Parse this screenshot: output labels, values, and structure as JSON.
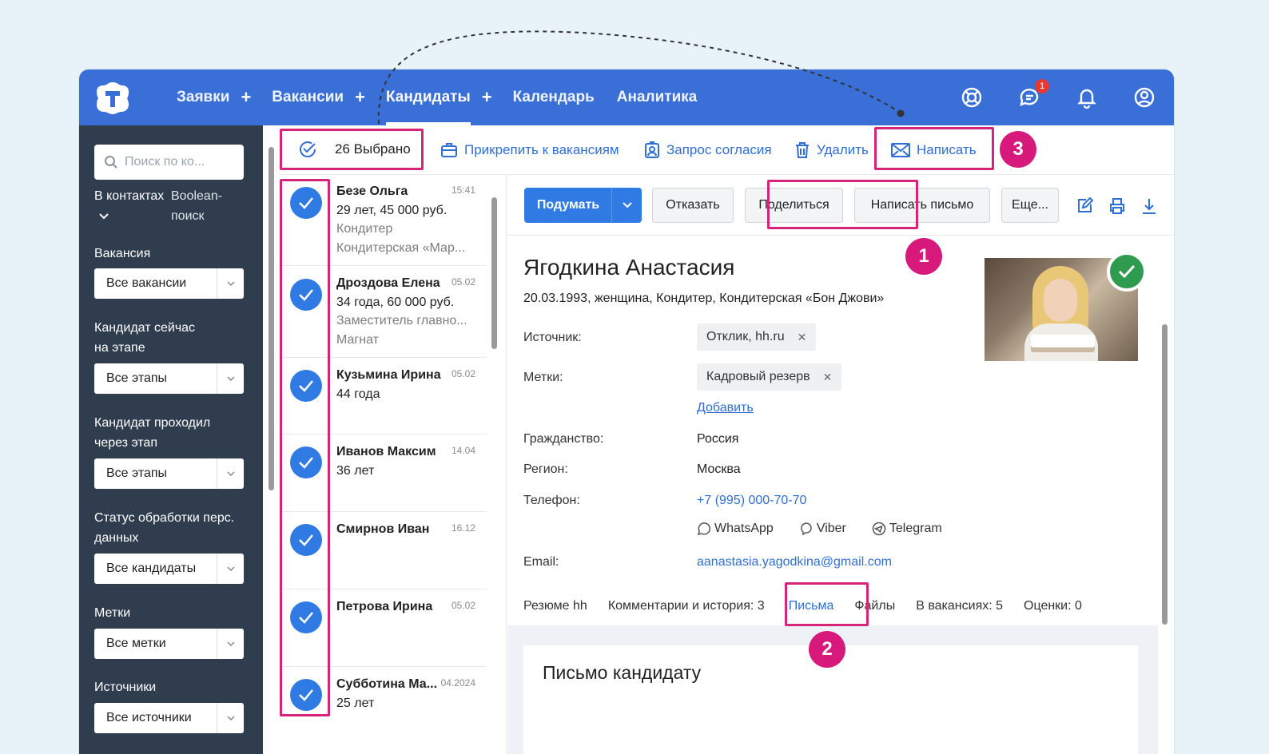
{
  "nav": {
    "items": [
      {
        "label": "Заявки",
        "plus": "+"
      },
      {
        "label": "Вакансии",
        "plus": "+"
      },
      {
        "label": "Кандидаты",
        "plus": "+"
      },
      {
        "label": "Календарь"
      },
      {
        "label": "Аналитика"
      }
    ],
    "notif_badge": "1"
  },
  "sidebar": {
    "search_placeholder": "Поиск по ко...",
    "in_contacts": "В контактах",
    "boolean1": "Boolean-",
    "boolean2": "поиск",
    "vacancy_label": "Вакансия",
    "vacancy_value": "Все вакансии",
    "stage_label1": "Кандидат сейчас",
    "stage_label2": "на этапе",
    "stage_value": "Все этапы",
    "passed_label1": "Кандидат проходил",
    "passed_label2": "через этап",
    "passed_value": "Все этапы",
    "status_label1": "Статус обработки перс.",
    "status_label2": "данных",
    "status_value": "Все кандидаты",
    "tags_label": "Метки",
    "tags_value": "Все метки",
    "sources_label": "Источники",
    "sources_value": "Все источники"
  },
  "toolbar": {
    "selected": "26 Выбрано",
    "attach": "Прикрепить к вакансиям",
    "consent": "Запрос согласия",
    "delete": "Удалить",
    "write": "Написать"
  },
  "candidates": [
    {
      "name": "Безе Ольга",
      "time": "15:41",
      "l1": "29 лет, 45 000 руб.",
      "l2": "Кондитер",
      "l3": "Кондитерская «Мар..."
    },
    {
      "name": "Дроздова Елена",
      "time": "05.02",
      "l1": "34 года, 60 000 руб.",
      "l2": "Заместитель главно...",
      "l3": "Магнат"
    },
    {
      "name": "Кузьмина Ирина",
      "time": "05.02",
      "l1": "44 года",
      "l2": "",
      "l3": ""
    },
    {
      "name": "Иванов Максим",
      "time": "14.04",
      "l1": "36 лет",
      "l2": "",
      "l3": ""
    },
    {
      "name": "Смирнов Иван",
      "time": "16.12",
      "l1": "",
      "l2": "",
      "l3": ""
    },
    {
      "name": "Петрова Ирина",
      "time": "05.02",
      "l1": "",
      "l2": "",
      "l3": ""
    },
    {
      "name": "Субботина Ма...",
      "time": "04.2024",
      "l1": "25 лет",
      "l2": "",
      "l3": ""
    }
  ],
  "actions": {
    "think": "Подумать",
    "reject": "Отказать",
    "share": "Поделиться",
    "write_letter": "Написать письмо",
    "more": "Еще..."
  },
  "person": {
    "name": "Ягодкина Анастасия",
    "info": "20.03.1993, женщина, Кондитер, Кондитерская «Бон Джови»",
    "source_label": "Источник:",
    "source_chip": "Отклик, hh.ru",
    "tags_label": "Метки:",
    "tag_chip": "Кадровый резерв",
    "add": "Добавить",
    "citizenship_label": "Гражданство:",
    "citizenship": "Россия",
    "region_label": "Регион:",
    "region": "Москва",
    "phone_label": "Телефон:",
    "phone": "+7 (995) 000-70-70",
    "whatsapp": "WhatsApp",
    "viber": "Viber",
    "telegram": "Telegram",
    "email_label": "Email:",
    "email": "aanastasia.yagodkina@gmail.com"
  },
  "tabs": [
    "Резюме hh",
    "Комментарии и история: 3",
    "Письма",
    "Файлы",
    "В вакансиях: 5",
    "Оценки: 0"
  ],
  "letter_title": "Письмо кандидату",
  "callouts": {
    "one": "1",
    "two": "2",
    "three": "3"
  },
  "colors": {
    "brand": "#3a6fd8",
    "sidebar": "#2f3d4f",
    "highlight": "#d6247b",
    "check": "#2f7be3"
  }
}
